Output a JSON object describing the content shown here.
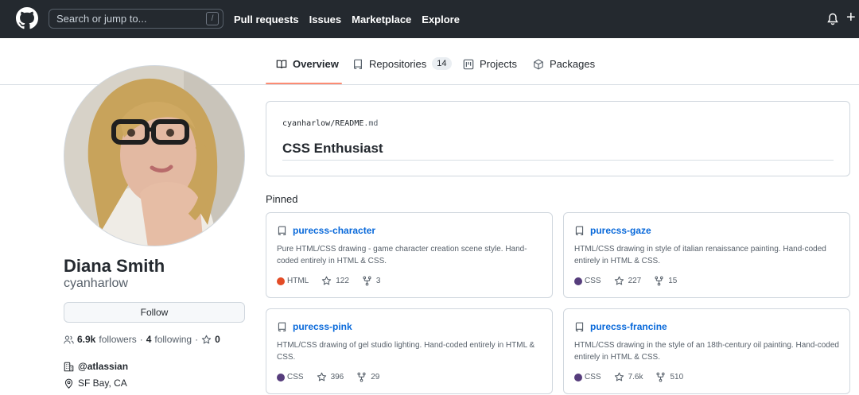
{
  "header": {
    "search_placeholder": "Search or jump to...",
    "search_shortcut": "/",
    "nav": [
      "Pull requests",
      "Issues",
      "Marketplace",
      "Explore"
    ],
    "plus_label": "+"
  },
  "tabs": [
    {
      "label": "Overview",
      "active": true,
      "icon": "book-icon"
    },
    {
      "label": "Repositories",
      "count": "14",
      "icon": "repo-icon"
    },
    {
      "label": "Projects",
      "icon": "project-icon"
    },
    {
      "label": "Packages",
      "icon": "package-icon"
    }
  ],
  "profile": {
    "name": "Diana Smith",
    "login": "cyanharlow",
    "follow_label": "Follow",
    "followers_count": "6.9k",
    "followers_label": "followers",
    "separator": "·",
    "following_count": "4",
    "following_label": "following",
    "stars_count": "0",
    "company": "@atlassian",
    "location": "SF Bay, CA"
  },
  "readme": {
    "owner": "cyanharlow",
    "slash": "/",
    "file_base": "README",
    "file_ext": ".md",
    "heading": "CSS Enthusiast"
  },
  "pinned": {
    "title": "Pinned",
    "cards": [
      {
        "name": "purecss-character",
        "description": "Pure HTML/CSS drawing - game character creation scene style. Hand-coded entirely in HTML & CSS.",
        "language": "HTML",
        "language_color": "#e34c26",
        "stars": "122",
        "forks": "3"
      },
      {
        "name": "purecss-gaze",
        "description": "HTML/CSS drawing in style of italian renaissance painting. Hand-coded entirely in HTML & CSS.",
        "language": "CSS",
        "language_color": "#563d7c",
        "stars": "227",
        "forks": "15"
      },
      {
        "name": "purecss-pink",
        "description": "HTML/CSS drawing of gel studio lighting. Hand-coded entirely in HTML & CSS.",
        "language": "CSS",
        "language_color": "#563d7c",
        "stars": "396",
        "forks": "29"
      },
      {
        "name": "purecss-francine",
        "description": "HTML/CSS drawing in the style of an 18th-century oil painting. Hand-coded entirely in HTML & CSS.",
        "language": "CSS",
        "language_color": "#563d7c",
        "stars": "7.6k",
        "forks": "510"
      }
    ]
  },
  "colors": {
    "header_bg": "#24292f",
    "link": "#0969da",
    "active_tab_underline": "#fd8c73"
  }
}
